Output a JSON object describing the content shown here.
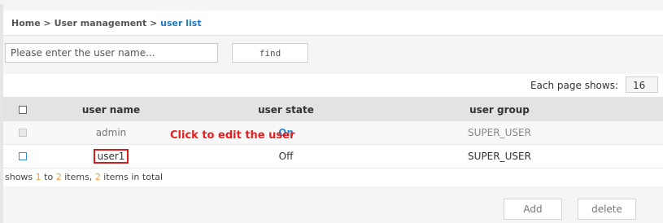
{
  "breadcrumb": {
    "home": "Home",
    "sep1": " > ",
    "section": "User management",
    "sep2": " > ",
    "current": "user list"
  },
  "search": {
    "placeholder": "Please enter the user name...",
    "value": "",
    "find_label": "find"
  },
  "pager": {
    "label": "Each page shows:",
    "value": "16"
  },
  "table": {
    "headers": {
      "name": "user name",
      "state": "user state",
      "group": "user group"
    },
    "rows": [
      {
        "name": "admin",
        "state": "On",
        "group": "SUPER_USER",
        "selectable": false
      },
      {
        "name": "user1",
        "state": "Off",
        "group": "SUPER_USER",
        "selectable": true
      }
    ]
  },
  "annotation": "Click to edit the user",
  "summary": {
    "prefix": "shows ",
    "from": "1",
    "to_word": " to ",
    "to": "2",
    "items_word": " items, ",
    "total": "2",
    "suffix": " items in total"
  },
  "actions": {
    "add_label": "Add",
    "delete_label": "delete"
  },
  "colors": {
    "link": "#1f78c1",
    "state_on": "#2a8fd8",
    "annotation": "#e32020",
    "highlight_box": "#d61a1a",
    "count_highlight": "#f2a033"
  }
}
